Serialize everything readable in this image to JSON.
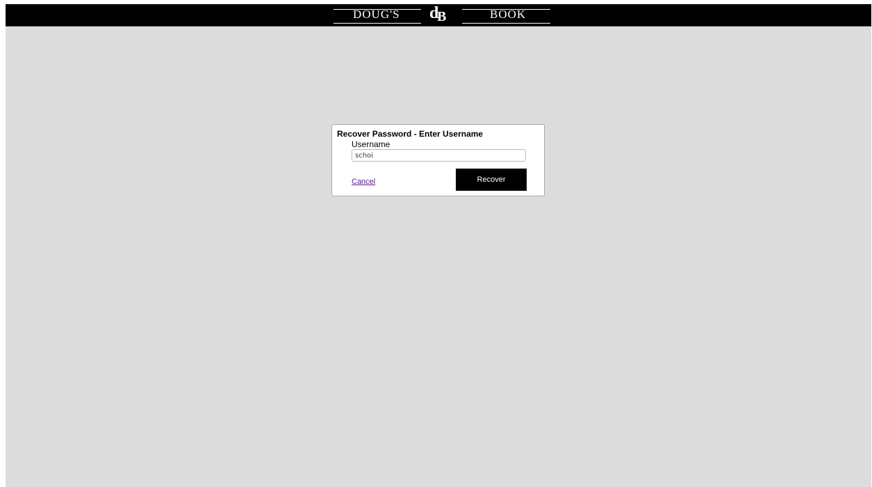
{
  "header": {
    "logo_left": "DOUG'S",
    "logo_monogram_d": "d",
    "logo_monogram_b": "B",
    "logo_right": "BOOK"
  },
  "dialog": {
    "title": "Recover Password - Enter Username",
    "username_label": "Username",
    "username_value": "schoi",
    "cancel_label": "Cancel",
    "recover_label": "Recover"
  },
  "colors": {
    "header_background": "#000000",
    "page_background": "#dcdcdc",
    "button_background": "#000000",
    "link_visited": "#551a8b"
  }
}
